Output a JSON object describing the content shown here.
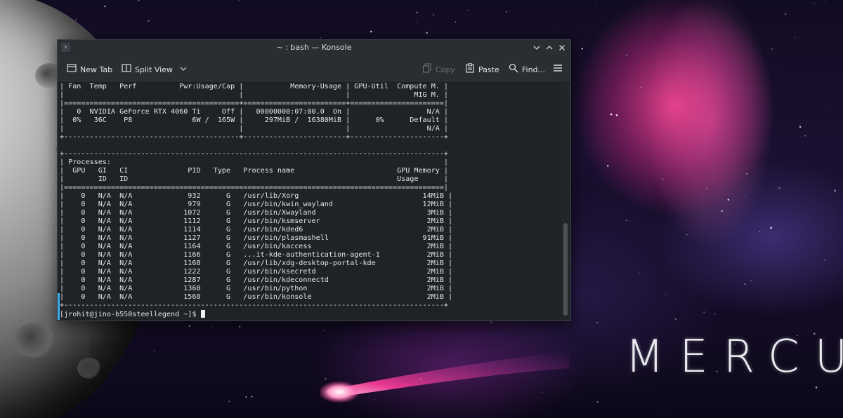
{
  "window": {
    "title": "~ : bash — Konsole"
  },
  "toolbar": {
    "new_tab": "New Tab",
    "split_view": "Split View",
    "copy": "Copy",
    "paste": "Paste",
    "find": "Find..."
  },
  "terminal": {
    "lines": [
      "| Fan  Temp   Perf          Pwr:Usage/Cap |           Memory-Usage | GPU-Util  Compute M. |",
      "|                                         |                        |               MIG M. |",
      "|=========================================+========================+======================|",
      "|   0  NVIDIA GeForce RTX 4060 Ti     Off |   00000000:07:00.0  On |                  N/A |",
      "|  0%   36C    P8              6W /  165W |     297MiB /  16380MiB |      0%      Default |",
      "|                                         |                        |                  N/A |",
      "+-----------------------------------------+------------------------+----------------------+",
      "",
      "+-----------------------------------------------------------------------------------------+",
      "| Processes:                                                                              |",
      "|  GPU   GI   CI              PID   Type   Process name                        GPU Memory |",
      "|        ID   ID                                                               Usage      |",
      "|=========================================================================================|",
      "|    0   N/A  N/A             932      G   /usr/lib/Xorg                             14MiB |",
      "|    0   N/A  N/A             979      G   /usr/bin/kwin_wayland                     12MiB |",
      "|    0   N/A  N/A            1072      G   /usr/bin/Xwayland                          3MiB |",
      "|    0   N/A  N/A            1112      G   /usr/bin/ksmserver                         2MiB |",
      "|    0   N/A  N/A            1114      G   /usr/bin/kded6                             2MiB |",
      "|    0   N/A  N/A            1127      G   /usr/bin/plasmashell                      91MiB |",
      "|    0   N/A  N/A            1164      G   /usr/bin/kaccess                           2MiB |",
      "|    0   N/A  N/A            1166      G   ...it-kde-authentication-agent-1           2MiB |",
      "|    0   N/A  N/A            1168      G   /usr/lib/xdg-desktop-portal-kde            2MiB |",
      "|    0   N/A  N/A            1222      G   /usr/bin/ksecretd                          2MiB |",
      "|    0   N/A  N/A            1287      G   /usr/bin/kdeconnectd                       2MiB |",
      "|    0   N/A  N/A            1360      G   /usr/bin/python                            2MiB |",
      "|    0   N/A  N/A            1568      G   /usr/bin/konsole                           2MiB |",
      "+-----------------------------------------------------------------------------------------+"
    ],
    "prompt": "[jrohit@jino-b550steellegend ~]$ "
  },
  "desktop": {
    "wallpaper_text": "MERCURY"
  },
  "colors": {
    "window_bg": "#232629",
    "terminal_bg": "#202326",
    "accent": "#3daee9",
    "nebula_pink": "#ff4696"
  },
  "icons": [
    "terminal-icon",
    "new-tab-icon",
    "split-view-icon",
    "chevron-down-icon",
    "copy-icon",
    "paste-icon",
    "search-icon",
    "hamburger-menu-icon",
    "minimize-icon",
    "maximize-icon",
    "close-icon"
  ]
}
